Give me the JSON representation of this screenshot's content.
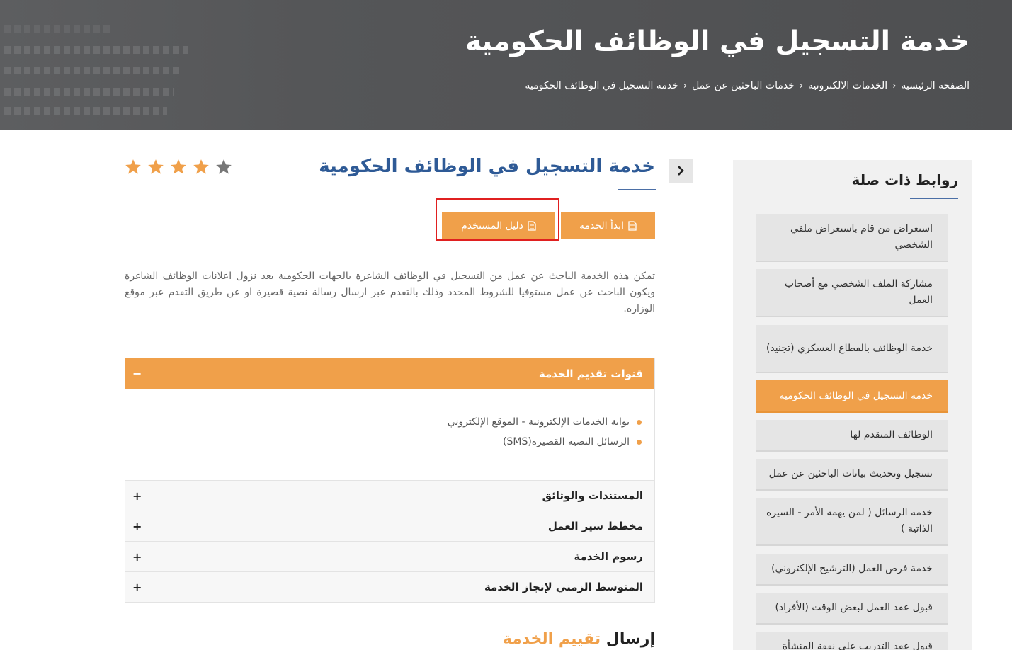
{
  "hero": {
    "title": "خدمة التسجيل في الوظائف الحكومية",
    "breadcrumb": [
      "الصفحة الرئيسية",
      "الخدمات الالكترونية",
      "خدمات الباحثين عن عمل",
      "خدمة التسجيل في الوظائف الحكومية"
    ]
  },
  "sidebar": {
    "title": "روابط ذات صلة",
    "items": [
      {
        "label": "استعراض من قام باستعراض ملفي الشخصي",
        "active": false
      },
      {
        "label": "مشاركة الملف الشخصي مع أصحاب العمل",
        "active": false
      },
      {
        "label": "خدمة الوظائف بالقطاع العسكري (تجنيد)",
        "active": false
      },
      {
        "label": "خدمة التسجيل في الوظائف الحكومية",
        "active": true
      },
      {
        "label": "الوظائف المتقدم لها",
        "active": false
      },
      {
        "label": "تسجيل وتحديث بيانات الباحثين عن عمل",
        "active": false
      },
      {
        "label": "خدمة الرسائل ( لمن يهمه الأمر - السيرة الذاتية )",
        "active": false
      },
      {
        "label": "خدمة فرص العمل (الترشيح الإلكتروني)",
        "active": false
      },
      {
        "label": "قبول عقد العمل لبعض الوقت (الأفراد)",
        "active": false
      },
      {
        "label": "قبول عقد التدريب على نفقة المنشأة",
        "active": false
      }
    ]
  },
  "main": {
    "title": "خدمة التسجيل في الوظائف الحكومية",
    "rating": {
      "value": 4,
      "max": 5
    },
    "start_button": "ابدأ الخدمة",
    "guide_button": "دليل المستخدم",
    "description": "تمكن هذه الخدمة الباحث عن عمل من التسجيل في الوظائف الشاغرة بالجهات الحكومية بعد نزول اعلانات الوظائف الشاغرة ويكون الباحث عن عمل مستوفيا للشروط المحدد وذلك بالتقدم عبر ارسال رسالة نصية قصيرة او عن طريق التقدم عبر موقع الوزارة."
  },
  "accordion": {
    "open_title": "قنوات تقديم الخدمة",
    "open_sign": "−",
    "channels": [
      "بوابة الخدمات الإلكترونية - الموقع الإلكتروني",
      "الرسائل النصية القصيرة(SMS)"
    ],
    "collapsed_sign": "+",
    "sections": [
      "المستندات والوثائق",
      "مخطط سير العمل",
      "رسوم الخدمة",
      "المتوسط الزمني لإنجاز الخدمة"
    ]
  },
  "rating_section": {
    "prefix": "إرسال",
    "accent": "تقييم الخدمة"
  },
  "colors": {
    "accent": "#f0a04a",
    "title_blue": "#2e5a96",
    "star_filled": "#f0a04a",
    "star_empty": "#777777"
  }
}
